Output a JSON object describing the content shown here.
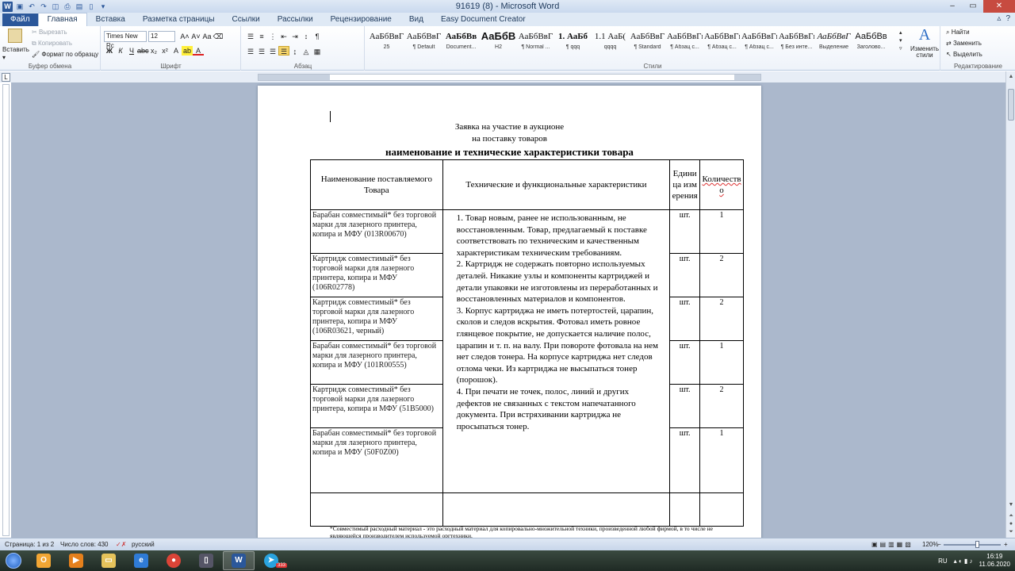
{
  "window": {
    "title": "91619 (8) - Microsoft Word",
    "qat_icons": [
      "word-app-icon",
      "save-icon",
      "undo-icon",
      "redo-icon",
      "print-preview-icon",
      "print-icon",
      "open-icon",
      "new-doc-icon"
    ]
  },
  "tabs": [
    {
      "label": "Файл"
    },
    {
      "label": "Главная"
    },
    {
      "label": "Вставка"
    },
    {
      "label": "Разметка страницы"
    },
    {
      "label": "Ссылки"
    },
    {
      "label": "Рассылки"
    },
    {
      "label": "Рецензирование"
    },
    {
      "label": "Вид"
    },
    {
      "label": "Easy Document Creator"
    }
  ],
  "ribbon": {
    "clipboard": {
      "label": "Буфер обмена",
      "paste": "Вставить",
      "cut": "Вырезать",
      "copy": "Копировать",
      "format_painter": "Формат по образцу"
    },
    "font": {
      "label": "Шрифт",
      "font_name": "Times New Rc",
      "font_size": "12"
    },
    "paragraph": {
      "label": "Абзац"
    },
    "styles": {
      "label": "Стили",
      "items": [
        {
          "preview": "АаБбВвГ",
          "name": "25"
        },
        {
          "preview": "АаБбВвГ",
          "name": "¶ Default"
        },
        {
          "preview": "АаБбВв",
          "name": "Document..."
        },
        {
          "preview": "АаБбВ",
          "name": "H2"
        },
        {
          "preview": "АаБбВвГ",
          "name": "¶ Normal ..."
        },
        {
          "preview": "1. АаБб",
          "name": "¶ qqq"
        },
        {
          "preview": "1.1 АаБ(",
          "name": "qqqq"
        },
        {
          "preview": "АаБбВвГ",
          "name": "¶ Standard"
        },
        {
          "preview": "АаБбВвГг,",
          "name": "¶ Абзац с..."
        },
        {
          "preview": "АаБбВвГг,",
          "name": "¶ Абзац с..."
        },
        {
          "preview": "АаБбВвГг,",
          "name": "¶ Абзац с..."
        },
        {
          "preview": "АаБбВвГг,",
          "name": "¶ Без инте..."
        },
        {
          "preview": "АаБбВвГ",
          "name": "Выделение"
        },
        {
          "preview": "АаБбВв",
          "name": "Заголово..."
        }
      ],
      "change_styles": "Изменить стили"
    },
    "editing": {
      "label": "Редактирование",
      "find": "Найти",
      "replace": "Заменить",
      "select": "Выделить"
    }
  },
  "document": {
    "heading_line1": "Заявка на участие в аукционе",
    "heading_line2": "на поставку товаров",
    "heading_line3": "наименование и технические характеристики товара",
    "table": {
      "header": {
        "name": "Наименование поставляемого Товара",
        "features": "Технические и функциональные характеристики",
        "unit": "Единица измерения",
        "qty": "Количество"
      },
      "rows": [
        {
          "name": "Барабан совместимый* без торговой марки для лазерного принтера, копира и МФУ (013R00670)",
          "unit": "шт.",
          "qty": "1"
        },
        {
          "name": "Картридж совместимый* без торговой марки для лазерного принтера, копира и МФУ (106R02778)",
          "unit": "шт.",
          "qty": "2"
        },
        {
          "name": "Картридж совместимый* без торговой марки для лазерного принтера, копира и МФУ (106R03621, черный)",
          "unit": "шт.",
          "qty": "2"
        },
        {
          "name": "Барабан совместимый* без торговой марки  для лазерного принтера, копира и МФУ (101R00555)",
          "unit": "шт.",
          "qty": "1"
        },
        {
          "name": "Картридж совместимый* без торговой марки для лазерного принтера, копира и МФУ (51B5000)",
          "unit": "шт.",
          "qty": "2"
        },
        {
          "name": "Барабан совместимый* без торговой марки  для лазерного принтера, копира и МФУ (50F0Z00)",
          "unit": "шт.",
          "qty": "1"
        }
      ],
      "features": [
        "1.    Товар  новым, ранее не использованным, не восстановленным. Товар, предлагаемый к поставке   соответствовать  по техническим  и качественным  характеристикам техническим требованиям.",
        "2.    Картридж не   содержать повторно используемых деталей. Никакие узлы и компоненты картриджей и детали упаковки не  изготовлены из переработанных и восстановленных материалов и компонентов.",
        "3.    Корпус картриджа не   иметь потертостей, царапин, сколов и следов вскрытия. Фотовал   иметь ровное глянцевое покрытие, не допускается наличие полос, царапин и т. п. на валу. При повороте фотовала на нем  нет следов тонера. На корпусе картриджа нет следов отлома чеки. Из картриджа не   высыпаться  тонер (порошок).",
        "4.    При печати не  точек, полос, линий и других дефектов  не связанных с текстом напечатанного документа. При встряхивании картриджа не   просыпаться тонер."
      ]
    },
    "footnote": "*Совместимый  расходный материал - это расходный материал для копировально-множительной техники, произведенной любой фирмой, в то числе не являющейся производителем используемой оргтехники."
  },
  "statusbar": {
    "page": "Страница: 1 из 2",
    "words": "Число слов: 430",
    "language": "русский",
    "zoom": "120%"
  },
  "taskbar": {
    "lang": "RU",
    "time": "16:19",
    "date": "11.06.2020",
    "badge": "333"
  }
}
